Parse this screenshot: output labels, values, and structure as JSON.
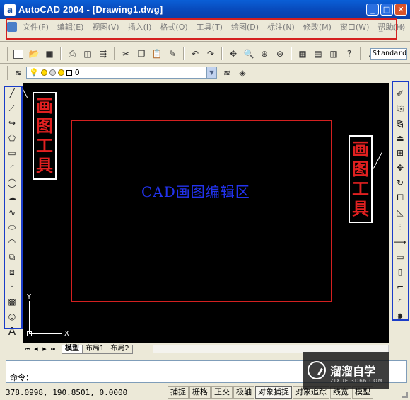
{
  "window": {
    "title": "AutoCAD 2004 - [Drawing1.dwg]",
    "icon_letter": "a",
    "min_glyph": "_",
    "max_glyph": "□",
    "close_glyph": "✕"
  },
  "menubar": {
    "items": [
      "文件(F)",
      "编辑(E)",
      "视图(V)",
      "插入(I)",
      "格式(O)",
      "工具(T)",
      "绘图(D)",
      "标注(N)",
      "修改(M)",
      "窗口(W)",
      "帮助(H)"
    ],
    "doc_min_glyph": "_",
    "doc_restore_glyph": "▫",
    "doc_close_glyph": "×"
  },
  "toolbar": {
    "icons": [
      "new-icon",
      "open-icon",
      "save-icon",
      "print-icon",
      "preview-icon",
      "publish-icon",
      "cut-icon",
      "copy-icon",
      "paste-icon",
      "match-properties-icon",
      "undo-icon",
      "redo-icon",
      "pan-icon",
      "zoom-realtime-icon",
      "zoom-window-icon",
      "zoom-previous-icon",
      "properties-icon",
      "design-center-icon",
      "tool-palettes-icon",
      "help-icon"
    ],
    "text_style_value": "Standard"
  },
  "layerbar": {
    "current_layer": "0"
  },
  "canvas": {
    "center_label": "CAD画图编辑区",
    "left_annotation": "画图工具",
    "right_annotation": "画图工具",
    "ucs_x": "X",
    "ucs_y": "Y"
  },
  "draw_toolbar": {
    "icons": [
      "line-icon",
      "construction-line-icon",
      "polyline-icon",
      "polygon-icon",
      "rectangle-icon",
      "arc-icon",
      "circle-icon",
      "revision-cloud-icon",
      "spline-icon",
      "ellipse-icon",
      "ellipse-arc-icon",
      "insert-block-icon",
      "make-block-icon",
      "point-icon",
      "hatch-icon",
      "region-icon",
      "multiline-text-icon"
    ]
  },
  "modify_toolbar": {
    "icons": [
      "erase-icon",
      "copy-object-icon",
      "mirror-icon",
      "offset-icon",
      "array-icon",
      "move-icon",
      "rotate-icon",
      "scale-icon",
      "stretch-icon",
      "trim-icon",
      "extend-icon",
      "break-icon",
      "break-at-point-icon",
      "chamfer-icon",
      "fillet-icon",
      "explode-icon"
    ]
  },
  "layout_tabs": {
    "tabs": [
      "模型",
      "布局1",
      "布局2"
    ],
    "active": "模型"
  },
  "command": {
    "prompt": "命令："
  },
  "status": {
    "coordinates": "378.0998,  190.8501,  0.0000",
    "toggles": [
      "捕捉",
      "栅格",
      "正交",
      "极轴",
      "对象捕捉",
      "对象追踪",
      "线宽",
      "模型"
    ],
    "on": [
      "对象捕捉"
    ]
  },
  "watermark": {
    "text": "溜溜自学",
    "sub": "ZIXUE.3D66.COM"
  },
  "colors": {
    "title_blue": "#0a5fd6",
    "canvas_bg": "#000000",
    "annotation_red": "#d42020",
    "annotation_blue": "#1a3cc8",
    "label_blue": "#2233ee"
  }
}
